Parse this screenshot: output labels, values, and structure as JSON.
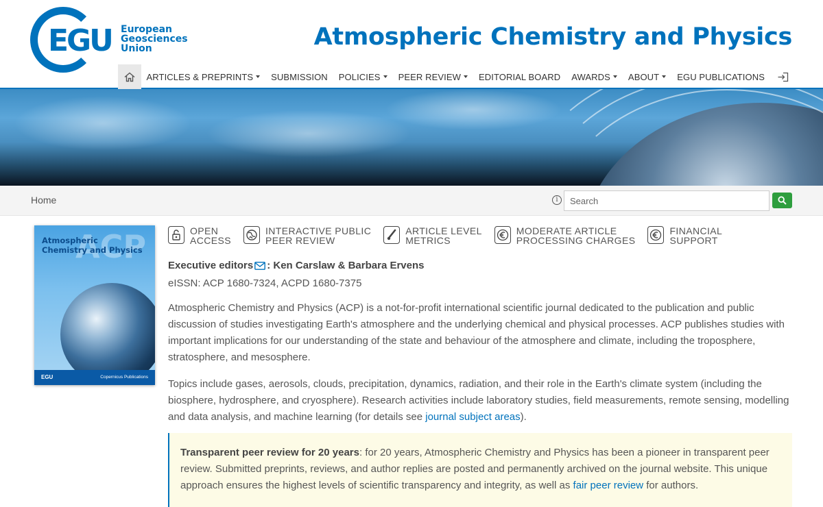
{
  "header": {
    "logo": {
      "letters": "EGU",
      "line1": "European",
      "line2": "Geosciences",
      "line3": "Union"
    },
    "journal_title": "Atmospheric Chemistry and Physics",
    "nav": [
      {
        "label": "ARTICLES & PREPRINTS",
        "dropdown": true
      },
      {
        "label": "SUBMISSION",
        "dropdown": false
      },
      {
        "label": "POLICIES",
        "dropdown": true
      },
      {
        "label": "PEER REVIEW",
        "dropdown": true
      },
      {
        "label": "EDITORIAL BOARD",
        "dropdown": false
      },
      {
        "label": "AWARDS",
        "dropdown": true
      },
      {
        "label": "ABOUT",
        "dropdown": true
      },
      {
        "label": "EGU PUBLICATIONS",
        "dropdown": false
      }
    ],
    "home_icon": "home-icon",
    "login_icon": "login-icon"
  },
  "breadcrumb": {
    "home": "Home",
    "search_placeholder": "Search"
  },
  "cover": {
    "title_line1": "Atmospheric",
    "title_line2": "Chemistry and Physics",
    "watermark": "ACP",
    "footer_left": "EGU",
    "footer_right": "Copernicus Publications"
  },
  "badges": [
    {
      "line1": "OPEN",
      "line2": "ACCESS",
      "icon": "open-access-icon"
    },
    {
      "line1": "INTERACTIVE PUBLIC",
      "line2": "PEER REVIEW",
      "icon": "globe-icon"
    },
    {
      "line1": "ARTICLE LEVEL",
      "line2": "METRICS",
      "icon": "thermometer-icon"
    },
    {
      "line1": "MODERATE ARTICLE",
      "line2": "PROCESSING CHARGES",
      "icon": "euro-icon"
    },
    {
      "line1": "FINANCIAL",
      "line2": "SUPPORT",
      "icon": "euro-icon"
    }
  ],
  "content": {
    "editors_label": "Executive editors",
    "editors_names": ": Ken Carslaw & Barbara Ervens",
    "issn": "eISSN: ACP 1680-7324, ACPD 1680-7375",
    "para1": "Atmospheric Chemistry and Physics (ACP) is a not-for-profit international scientific journal dedicated to the publication and public discussion of studies investigating Earth's atmosphere and the underlying chemical and physical processes. ACP publishes studies with important implications for our understanding of the state and behaviour of the atmosphere and climate, including the troposphere, stratosphere, and mesosphere.",
    "para2_before": "Topics include gases, aerosols, clouds, precipitation, dynamics, radiation, and their role in the Earth's climate system (including the biosphere, hydrosphere, and cryosphere). Research activities include laboratory studies, field measurements, remote sensing, modelling and data analysis, and machine learning (for details see ",
    "para2_link": "journal subject areas",
    "para2_after": ")."
  },
  "note": {
    "bold": "Transparent peer review for 20 years",
    "text_before": ": for 20 years, Atmospheric Chemistry and Physics has been a pioneer in transparent peer review. Submitted preprints, reviews, and author replies are posted and permanently archived on the journal website. This unique approach ensures the highest levels of scientific transparency and integrity, as well as ",
    "link": "fair peer review",
    "text_after": " for authors."
  },
  "colors": {
    "brand_blue": "#0072bc",
    "search_green": "#2e9e3e",
    "note_bg": "#fdfbe6"
  }
}
